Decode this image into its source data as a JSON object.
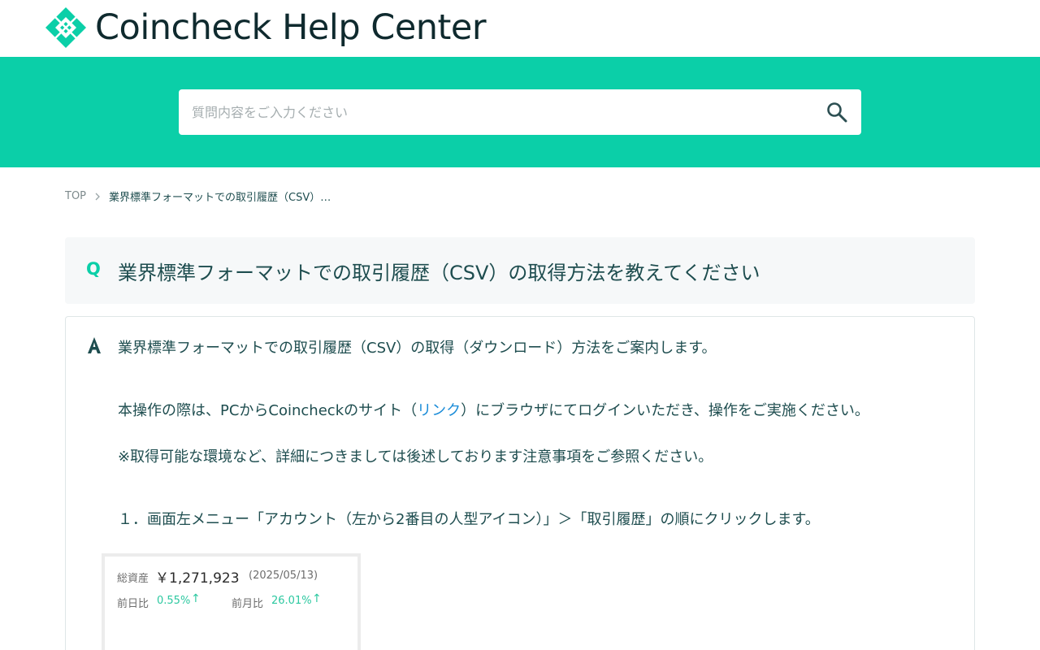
{
  "header": {
    "logo_text": "Coincheck Help Center"
  },
  "search": {
    "placeholder": "質問内容をご入力ください",
    "icon": "search-icon"
  },
  "breadcrumb": {
    "top": "TOP",
    "current": "業界標準フォーマットでの取引履歴（CSV）…"
  },
  "question": {
    "mark": "Q",
    "title": "業界標準フォーマットでの取引履歴（CSV）の取得方法を教えてください"
  },
  "answer": {
    "mark": "A",
    "intro": "業界標準フォーマットでの取引履歴（CSV）の取得（ダウンロード）方法をご案内します。",
    "line2_before": "本操作の際は、PCからCoincheckのサイト（",
    "line2_link": "リンク",
    "line2_after": "）にブラウザにてログインいただき、操作をご実施ください。",
    "note": "※取得可能な環境など、詳細につきましては後述しております注意事項をご参照ください。",
    "step1": "１．画面左メニュー「アカウント（左から2番目の人型アイコン）」＞「取引履歴」の順にクリックします。"
  },
  "screenshot": {
    "total_assets_label": "総資産",
    "total_assets_value": "￥1,271,923",
    "date": "(2025/05/13)",
    "day_label": "前日比",
    "day_value": "0.55%",
    "month_label": "前月比",
    "month_value": "26.01%"
  },
  "colors": {
    "brand": "#0bcfa8",
    "text": "#1e4d4f",
    "link": "#1a8cd8"
  }
}
